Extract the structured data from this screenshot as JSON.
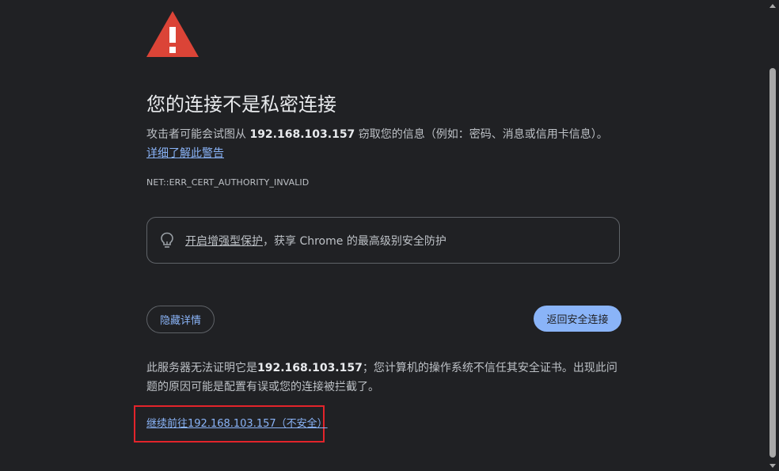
{
  "interstitial": {
    "title": "您的连接不是私密连接",
    "desc_pre": "攻击者可能会试图从 ",
    "host": "192.168.103.157",
    "desc_post": " 窃取您的信息（例如：密码、消息或信用卡信息）。",
    "learn_more": "详细了解此警告",
    "error_code": "NET::ERR_CERT_AUTHORITY_INVALID"
  },
  "enhanced": {
    "icon": "lightbulb-icon",
    "link": "开启增强型保护",
    "text": "，获享 Chrome 的最高级别安全防护"
  },
  "buttons": {
    "details": "隐藏详情",
    "back": "返回安全连接"
  },
  "details": {
    "pre": "此服务器无法证明它是",
    "host": "192.168.103.157",
    "post": "；您计算机的操作系统不信任其安全证书。出现此问题的原因可能是配置有误或您的连接被拦截了。"
  },
  "proceed": {
    "label": "继续前往192.168.103.157（不安全）"
  },
  "colors": {
    "background": "#202124",
    "accent": "#8ab4f8",
    "warning_icon": "#db4437",
    "highlight_frame": "#e3242b"
  }
}
